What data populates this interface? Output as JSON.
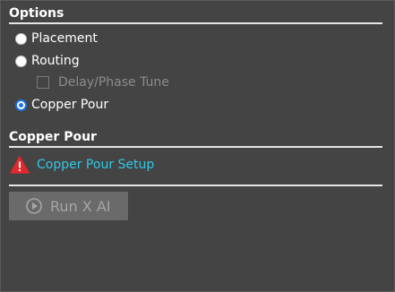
{
  "options": {
    "header": "Options",
    "placement_label": "Placement",
    "routing_label": "Routing",
    "delay_phase_label": "Delay/Phase Tune",
    "copper_pour_label": "Copper Pour",
    "selected": "copper_pour"
  },
  "copper_pour": {
    "header": "Copper Pour",
    "setup_link": "Copper Pour Setup",
    "warning_icon": "warning-triangle-icon"
  },
  "run": {
    "label": "Run X AI",
    "icon": "play-circle-icon",
    "enabled": false
  },
  "colors": {
    "background": "#444444",
    "link": "#2ec8e6",
    "warning": "#e0282e",
    "selected_radio": "#1a73e8",
    "disabled_button": "#6a6a6a"
  }
}
